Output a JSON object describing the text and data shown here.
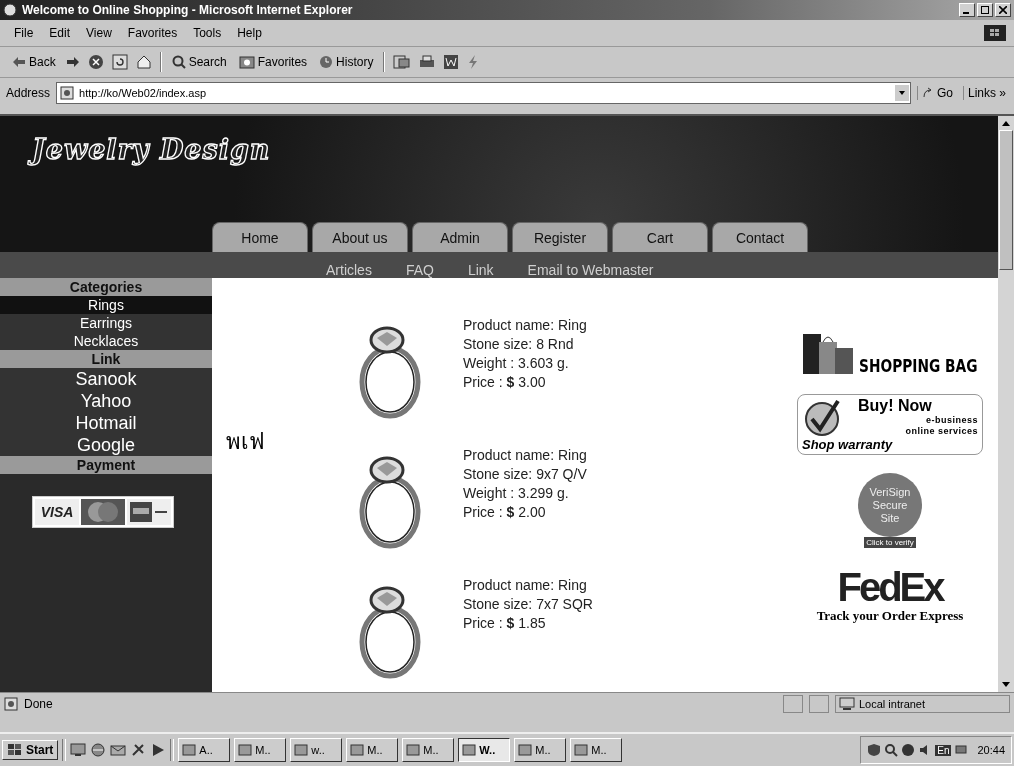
{
  "window": {
    "title": "Welcome to Online Shopping - Microsoft Internet Explorer"
  },
  "menu": [
    "File",
    "Edit",
    "View",
    "Favorites",
    "Tools",
    "Help"
  ],
  "toolbar": [
    {
      "kind": "back",
      "label": "Back"
    },
    {
      "kind": "search",
      "label": "Search"
    },
    {
      "kind": "favorites",
      "label": "Favorites"
    },
    {
      "kind": "history",
      "label": "History"
    }
  ],
  "address": {
    "label": "Address",
    "value": "http://ko/Web02/index.asp",
    "go": "Go",
    "links": "Links »"
  },
  "site": {
    "logo": "Jewelry Design",
    "tabs": [
      "Home",
      "About us",
      "Admin",
      "Register",
      "Cart",
      "Contact"
    ],
    "subnav": [
      "Articles",
      "FAQ",
      "Link",
      "Email to Webmaster"
    ],
    "sidebar": [
      {
        "kind": "header",
        "label": "Categories"
      },
      {
        "kind": "link",
        "label": "Rings"
      },
      {
        "kind": "link",
        "label": "Earrings"
      },
      {
        "kind": "link",
        "label": "Necklaces"
      },
      {
        "kind": "header",
        "label": "Link"
      },
      {
        "kind": "big",
        "label": "Sanook"
      },
      {
        "kind": "big",
        "label": "Yahoo"
      },
      {
        "kind": "big",
        "label": "Hotmail"
      },
      {
        "kind": "big",
        "label": "Google"
      },
      {
        "kind": "header",
        "label": "Payment"
      }
    ],
    "payment_card": "VISA",
    "thai_text": "พเฟ",
    "products": [
      {
        "lines": [
          "Product name: Ring",
          "Stone size: 8 Rnd",
          "Weight : 3.603 g."
        ],
        "price_label": "Price :",
        "price": "**$** 3.00"
      },
      {
        "lines": [
          "Product name: Ring",
          "Stone size: 9x7 Q/V",
          "Weight : 3.299 g."
        ],
        "price_label": "Price :",
        "price": "**$** 2.00"
      },
      {
        "lines": [
          "Product name: Ring",
          "Stone size: 7x7 SQR"
        ],
        "price_label": "Price :",
        "price": "**$** 1.85"
      }
    ],
    "ads": {
      "shopping_bag": "SHOPPING BAG",
      "buy_now": "Buy! Now",
      "ebusiness": "e-business",
      "online": "online services",
      "warranty": "Shop warranty",
      "secure": [
        "VeriSign",
        "Secure",
        "Site"
      ],
      "verify": "Click to verify",
      "fedex": "FedEx",
      "track": "Track your Order Express"
    }
  },
  "status": {
    "text": "Done",
    "zone": "Local intranet"
  },
  "taskbar": {
    "start": "Start",
    "items": [
      {
        "label": "A..",
        "selected": false
      },
      {
        "label": "M..",
        "selected": false
      },
      {
        "label": "w..",
        "selected": false
      },
      {
        "label": "M..",
        "selected": false
      },
      {
        "label": "M..",
        "selected": false
      },
      {
        "label": "W..",
        "selected": true
      },
      {
        "label": "M..",
        "selected": false
      },
      {
        "label": "M..",
        "selected": false
      }
    ],
    "lang": "En",
    "time": "20:44"
  }
}
